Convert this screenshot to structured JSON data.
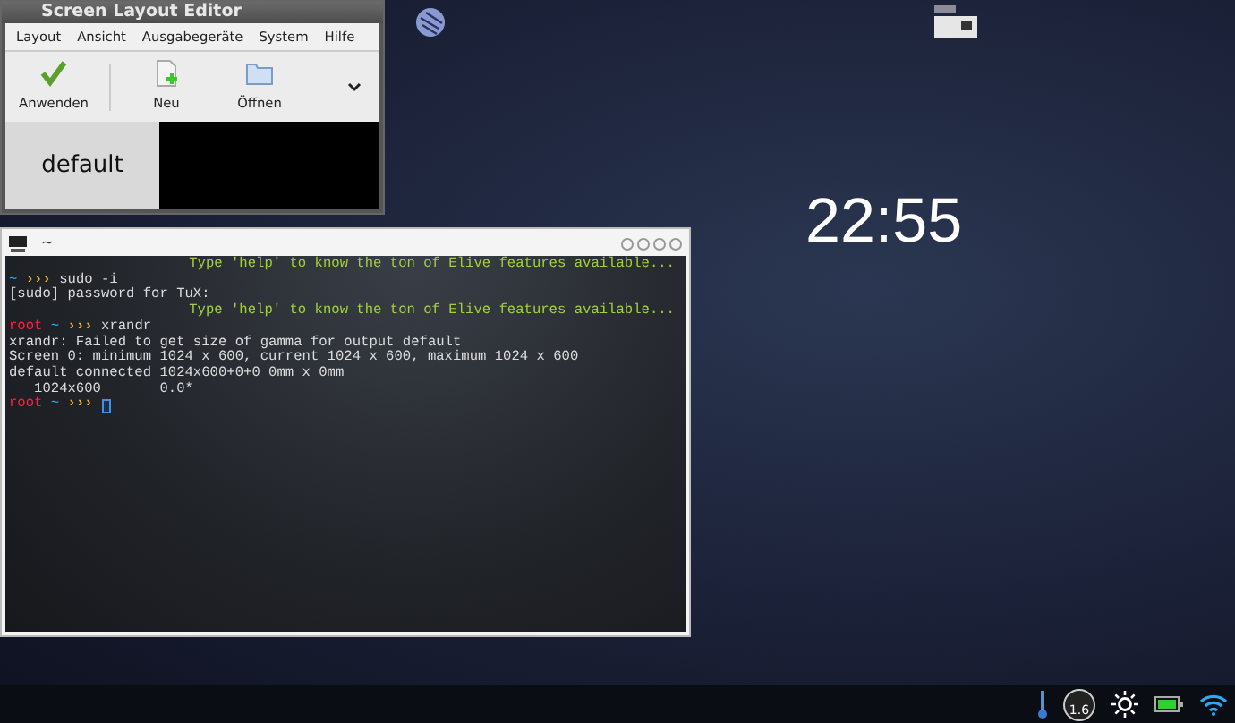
{
  "editor": {
    "title": "Screen Layout Editor",
    "menu": [
      "Layout",
      "Ansicht",
      "Ausgabegeräte",
      "System",
      "Hilfe"
    ],
    "toolbar": [
      {
        "label": "Anwenden",
        "kind": "apply"
      },
      {
        "label": "Neu",
        "kind": "new"
      },
      {
        "label": "Öffnen",
        "kind": "open"
      }
    ],
    "screens": [
      {
        "label": "default"
      }
    ]
  },
  "terminal": {
    "title": "~",
    "lines": [
      {
        "kind": "banner",
        "text": "Type 'help' to know the ton of Elive features available..."
      },
      {
        "kind": "prompt",
        "dir": "~",
        "arrows": "›››",
        "command": "sudo -i"
      },
      {
        "kind": "output",
        "text": "[sudo] password for TuX:"
      },
      {
        "kind": "banner",
        "text": "Type 'help' to know the ton of Elive features available..."
      },
      {
        "kind": "prompt",
        "user": "root",
        "dir": "~",
        "arrows": "›››",
        "command": "xrandr"
      },
      {
        "kind": "output",
        "text": "xrandr: Failed to get size of gamma for output default"
      },
      {
        "kind": "output",
        "text": "Screen 0: minimum 1024 x 600, current 1024 x 600, maximum 1024 x 600"
      },
      {
        "kind": "output",
        "text": "default connected 1024x600+0+0 0mm x 0mm"
      },
      {
        "kind": "output",
        "text": "   1024x600       0.0*"
      },
      {
        "kind": "prompt",
        "user": "root",
        "dir": "~",
        "arrows": "›››",
        "cursor": true
      }
    ]
  },
  "clock": "22:55",
  "tray": {
    "gauge_reading": "1.6"
  }
}
